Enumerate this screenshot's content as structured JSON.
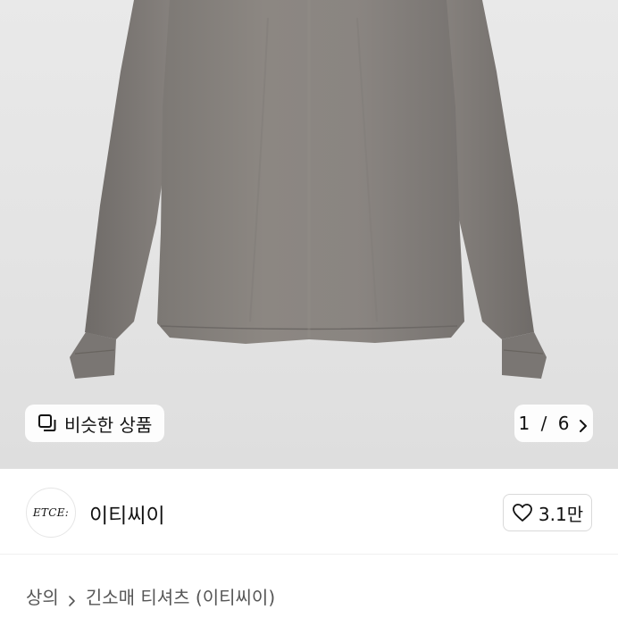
{
  "product_image": {
    "alt": ""
  },
  "image_overlay": {
    "similar_label": "비슷한 상품",
    "pager": {
      "current": "1",
      "separator": "/",
      "total": "6"
    }
  },
  "store": {
    "logo_text": "ETCE:",
    "name": "이티씨이",
    "likes": "3.1만"
  },
  "breadcrumb": {
    "items": [
      "상의",
      "긴소매 티셔츠 (이티씨이)"
    ]
  },
  "colors": {
    "shirt": "#8a8580",
    "shirt_shadow": "#6f6a66",
    "background": "#e6e6e6",
    "text": "#111111",
    "muted": "#555555"
  },
  "icons": {
    "similar": "copy-squares-icon",
    "pager_next": "chevron-right-icon",
    "like": "heart-outline-icon",
    "breadcrumb_sep": "chevron-right-icon"
  }
}
